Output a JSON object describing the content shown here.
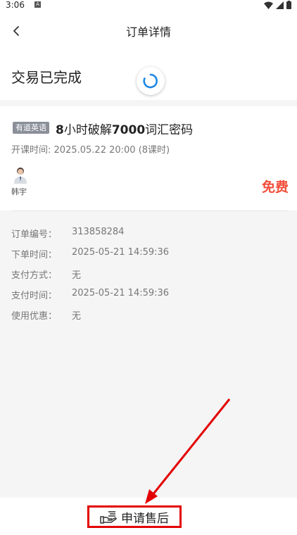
{
  "status_bar": {
    "time": "3:06",
    "a_label": "A"
  },
  "header": {
    "title": "订单详情"
  },
  "order": {
    "status": "交易已完成"
  },
  "course": {
    "tag": "有道英语",
    "title_prefix": "8",
    "title_mid1": "小时破解",
    "title_num": "7000",
    "title_mid2": "词汇密码",
    "time_label": "开课时间:",
    "time_value": "2025.05.22 20:00",
    "lessons": "(8课时)",
    "teacher": "韩宇",
    "price": "免费"
  },
  "info": [
    {
      "label": "订单编号：",
      "value": "313858284"
    },
    {
      "label": "下单时间：",
      "value": "2025-05-21 14:59:36"
    },
    {
      "label": "支付方式：",
      "value": "无"
    },
    {
      "label": "支付时间：",
      "value": "2025-05-21 14:59:36"
    },
    {
      "label": "使用优惠：",
      "value": "无"
    }
  ],
  "footer": {
    "after_sale_label": "申请售后"
  },
  "colors": {
    "price": "#f24e3b",
    "annotation": "#e30000",
    "spinner": "#1e88e5"
  }
}
